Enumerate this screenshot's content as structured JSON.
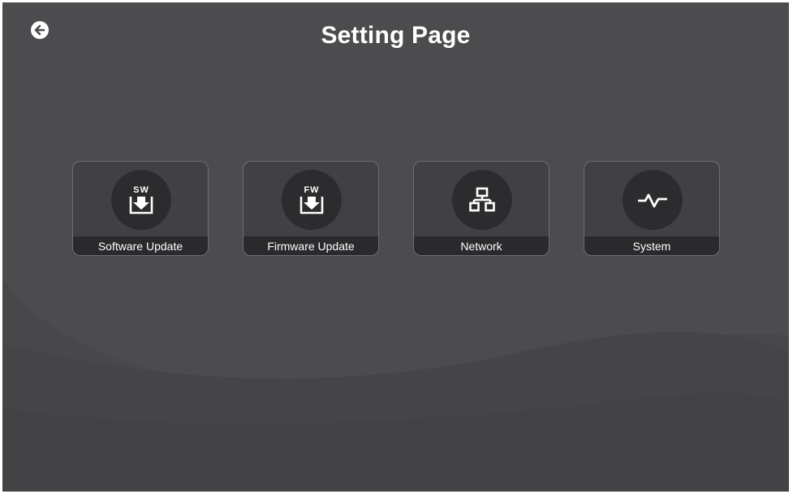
{
  "header": {
    "title": "Setting Page",
    "back_icon": "arrow-left-circle-icon"
  },
  "tiles": [
    {
      "label": "Software Update",
      "icon": "software-download-icon",
      "icon_text": "SW"
    },
    {
      "label": "Firmware Update",
      "icon": "firmware-download-icon",
      "icon_text": "FW"
    },
    {
      "label": "Network",
      "icon": "network-icon"
    },
    {
      "label": "System",
      "icon": "pulse-icon"
    }
  ],
  "colors": {
    "background": "#4c4b4e",
    "tile": "#414043",
    "tile_label_bar": "#2a292c",
    "icon_circle": "#2c2b2e",
    "text": "#ffffff"
  }
}
